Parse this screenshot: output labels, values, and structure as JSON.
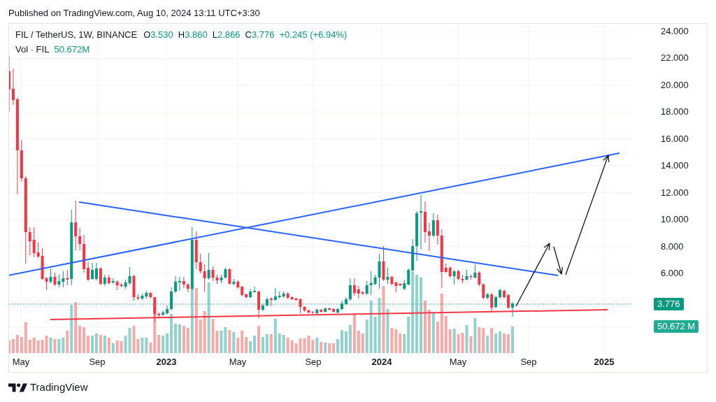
{
  "header": {
    "published": "Published on TradingView.com, Aug 10, 2024 13:11 UTC+3:30"
  },
  "chart": {
    "rising": true,
    "legend": {
      "symbol": "FIL / TetherUS, 1W, BINANCE",
      "ohlc": [
        {
          "label": "O",
          "value": "3.530"
        },
        {
          "label": "H",
          "value": "3.860"
        },
        {
          "label": "L",
          "value": "2.866"
        },
        {
          "label": "C",
          "value": "3.776"
        }
      ],
      "change": "+0.245 (+6.94%)"
    },
    "volume_legend": {
      "label": "Vol · FIL",
      "value": "50.672M"
    },
    "price_axis": {
      "labels": [
        "24.000",
        "22.000",
        "20.000",
        "18.000",
        "16.000",
        "14.000",
        "12.000",
        "10.000",
        "8.000",
        "6.000"
      ]
    },
    "last_price": "3.776",
    "last_volume": "50.672 M",
    "time_axis": {
      "labels": [
        {
          "text": "May",
          "kind": "month"
        },
        {
          "text": "Sep",
          "kind": "month"
        },
        {
          "text": "2023",
          "kind": "year"
        },
        {
          "text": "May",
          "kind": "month"
        },
        {
          "text": "Sep",
          "kind": "month"
        },
        {
          "text": "2024",
          "kind": "year"
        },
        {
          "text": "May",
          "kind": "month"
        },
        {
          "text": "Sep",
          "kind": "month"
        },
        {
          "text": "2025",
          "kind": "year"
        }
      ]
    }
  },
  "footer": {
    "brand": "TradingView"
  }
}
